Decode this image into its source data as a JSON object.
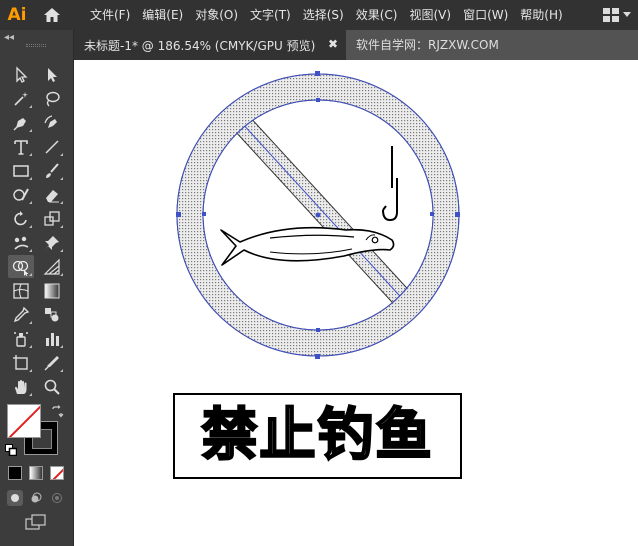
{
  "app": {
    "logo": "Ai"
  },
  "menu": [
    {
      "id": "file",
      "label": "文件(F)"
    },
    {
      "id": "edit",
      "label": "编辑(E)"
    },
    {
      "id": "object",
      "label": "对象(O)"
    },
    {
      "id": "type",
      "label": "文字(T)"
    },
    {
      "id": "select",
      "label": "选择(S)"
    },
    {
      "id": "effect",
      "label": "效果(C)"
    },
    {
      "id": "view",
      "label": "视图(V)"
    },
    {
      "id": "window",
      "label": "窗口(W)"
    },
    {
      "id": "help",
      "label": "帮助(H)"
    }
  ],
  "tabs": {
    "active": "未标题-1* @ 186.54% (CMYK/GPU 预览)",
    "close": "✖",
    "other": "软件自学网：RJZXW.COM"
  },
  "toolbar": {
    "collapse": "◂◂"
  },
  "artwork": {
    "sign_text": "禁止钓鱼"
  },
  "colors": {
    "menubar": "#323232",
    "toolbar": "#3c3c3c",
    "tabbar": "#535353",
    "selection": "#3f51c8",
    "ring_fill": "#d7d7d7",
    "logo": "#ff9a00"
  }
}
